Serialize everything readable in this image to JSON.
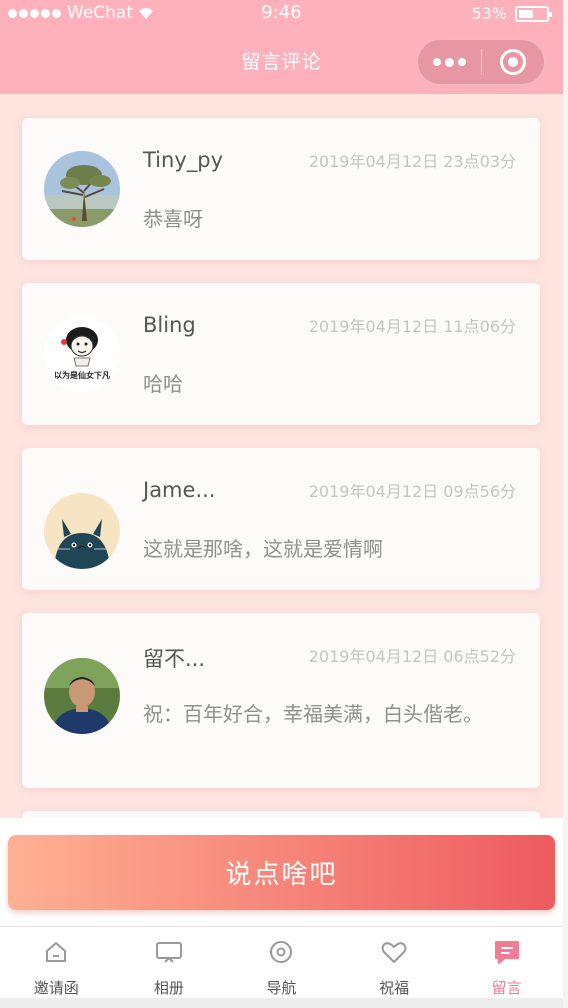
{
  "status_bar": {
    "carrier": "WeChat",
    "time": "9:46",
    "battery_text": "53%",
    "battery_level": 0.53
  },
  "nav": {
    "title": "留言评论"
  },
  "comments": [
    {
      "name": "Tiny_py",
      "date": "2019年04月12日 23点03分",
      "message": "恭喜呀",
      "avatar": "tree-photo-avatar"
    },
    {
      "name": "Bling",
      "date": "2019年04月12日 11点06分",
      "message": "哈哈",
      "avatar": "meme-face-avatar",
      "avatar_caption": "以为是仙女下凡"
    },
    {
      "name": "Jame...",
      "date": "2019年04月12日 09点56分",
      "message": "这就是那啥，这就是爱情啊",
      "avatar": "totoro-avatar"
    },
    {
      "name": "留不...",
      "date": "2019年04月12日 06点52分",
      "message": "祝：百年好合，幸福美满，白头偕老。",
      "avatar": "person-photo-avatar"
    }
  ],
  "action": {
    "label": "说点啥吧"
  },
  "tabs": [
    {
      "label": "邀请函",
      "icon": "home-icon",
      "active": false
    },
    {
      "label": "相册",
      "icon": "album-icon",
      "active": false
    },
    {
      "label": "导航",
      "icon": "location-pin-icon",
      "active": false
    },
    {
      "label": "祝福",
      "icon": "heart-icon",
      "active": false
    },
    {
      "label": "留言",
      "icon": "message-icon",
      "active": true
    }
  ],
  "colors": {
    "header": "#ffb1bb",
    "page_bg": "#fde4df",
    "active_tab": "#f27c91",
    "button_gradient_start": "#ffb094",
    "button_gradient_end": "#ee5b5f"
  }
}
